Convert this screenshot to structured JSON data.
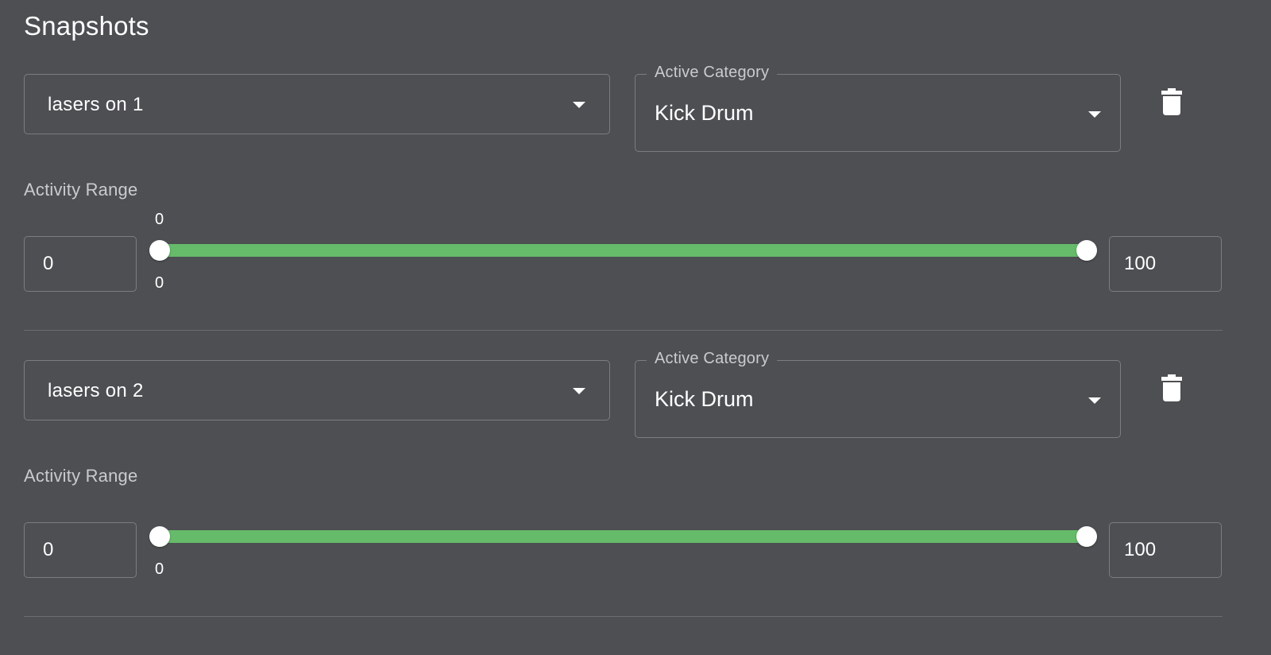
{
  "section": {
    "title": "Snapshots"
  },
  "snapshots": [
    {
      "snapshot_select": "lasers on 1",
      "category_legend": "Active Category",
      "category_value": "Kick Drum",
      "range_label": "Activity Range",
      "min_value": "0",
      "max_value": "100",
      "slider_low": 0,
      "slider_high": 100,
      "top_label": "0",
      "bottom_label": "0",
      "accent": "#66bb6a"
    },
    {
      "snapshot_select": "lasers on 2",
      "category_legend": "Active Category",
      "category_value": "Kick Drum",
      "range_label": "Activity Range",
      "min_value": "0",
      "max_value": "100",
      "slider_low": 0,
      "slider_high": 100,
      "bottom_label": "0",
      "accent": "#66bb6a"
    }
  ],
  "icons": {
    "delete": "trash-icon",
    "dropdown": "chevron-down-icon"
  }
}
